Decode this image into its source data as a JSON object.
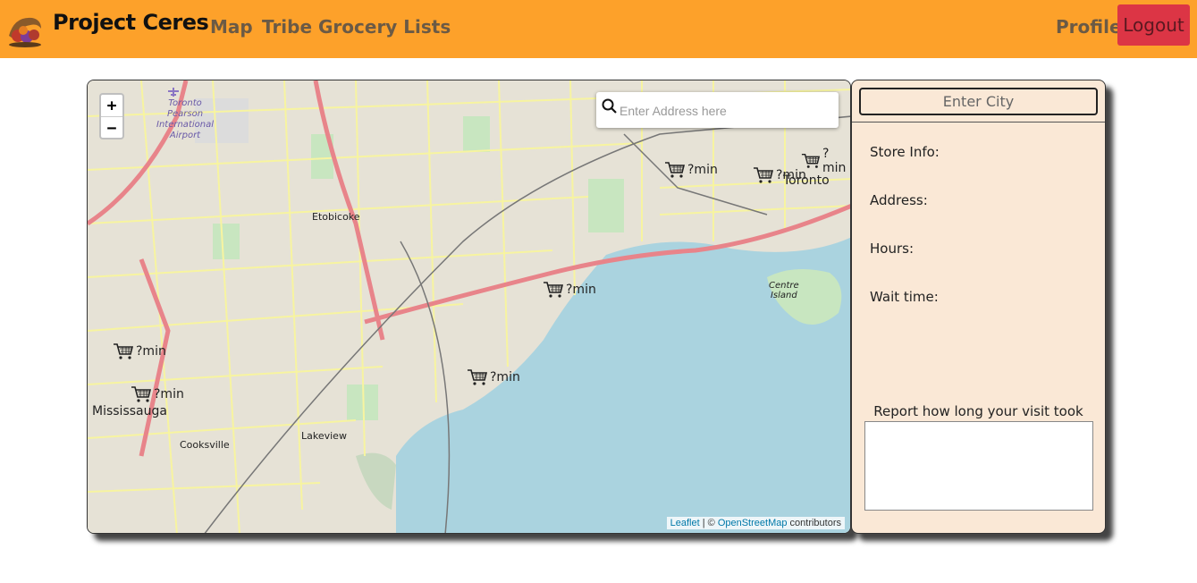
{
  "navbar": {
    "brand": "Project Ceres",
    "links": [
      "Map",
      "Tribe",
      "Grocery Lists"
    ],
    "profile": "Profile",
    "logout": "Logout"
  },
  "map": {
    "search_placeholder": "Enter Address here",
    "zoom_in": "+",
    "zoom_out": "−",
    "attribution": {
      "leaflet": "Leaflet",
      "sep": " | © ",
      "osm": "OpenStreetMap",
      "suffix": " contributors"
    },
    "places": {
      "toronto": "Toronto",
      "mississauga": "Mississauga",
      "etobicoke": "Etobicoke",
      "lakeview": "Lakeview",
      "cooksville": "Cooksville",
      "centre_island_1": "Centre",
      "centre_island_2": "Island",
      "airport_1": "Toronto",
      "airport_2": "Pearson",
      "airport_3": "International",
      "airport_4": "Airport"
    },
    "store_markers": [
      "?min",
      "?min",
      "?min",
      "?min",
      "?min",
      "?min",
      "?min"
    ]
  },
  "sidebar": {
    "city_placeholder": "Enter City",
    "store_info": "Store Info:",
    "address": "Address:",
    "hours": "Hours:",
    "wait_time": "Wait time:",
    "report_label": "Report how long your visit took"
  }
}
